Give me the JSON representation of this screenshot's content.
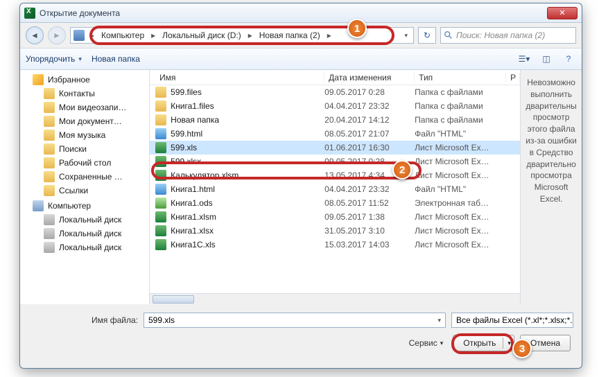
{
  "title": "Открытие документа",
  "breadcrumb": [
    "Компьютер",
    "Локальный диск (D:)",
    "Новая папка (2)"
  ],
  "search_placeholder": "Поиск: Новая папка (2)",
  "toolbar": {
    "organize": "Упорядочить",
    "newfolder": "Новая папка"
  },
  "sidebar": {
    "favorites": "Избранное",
    "items1": [
      "Контакты",
      "Мои видеозапи…",
      "Мои документ…",
      "Моя музыка",
      "Поиски",
      "Рабочий стол",
      "Сохраненные …",
      "Ссылки"
    ],
    "computer": "Компьютер",
    "drives": [
      "Локальный диск",
      "Локальный диск",
      "Локальный диск"
    ]
  },
  "columns": {
    "name": "Имя",
    "date": "Дата изменения",
    "type": "Тип",
    "r": "Р"
  },
  "files": [
    {
      "icon": "folder",
      "name": "599.files",
      "date": "09.05.2017 0:28",
      "type": "Папка с файлами"
    },
    {
      "icon": "folder",
      "name": "Книга1.files",
      "date": "04.04.2017 23:32",
      "type": "Папка с файлами"
    },
    {
      "icon": "folder",
      "name": "Новая папка",
      "date": "20.04.2017 14:12",
      "type": "Папка с файлами"
    },
    {
      "icon": "html",
      "name": "599.html",
      "date": "08.05.2017 21:07",
      "type": "Файл \"HTML\""
    },
    {
      "icon": "xls",
      "name": "599.xls",
      "date": "01.06.2017 16:30",
      "type": "Лист Microsoft Ex…",
      "selected": true
    },
    {
      "icon": "xls",
      "name": "599.xlsx",
      "date": "09.05.2017 0:28",
      "type": "Лист Microsoft Ex…"
    },
    {
      "icon": "xls",
      "name": "Калькулятор.xlsm",
      "date": "13.05.2017 4:34",
      "type": "Лист Microsoft Ex…"
    },
    {
      "icon": "html",
      "name": "Книга1.html",
      "date": "04.04.2017 23:32",
      "type": "Файл \"HTML\""
    },
    {
      "icon": "ods",
      "name": "Книга1.ods",
      "date": "08.05.2017 11:52",
      "type": "Электронная таб…"
    },
    {
      "icon": "xls",
      "name": "Книга1.xlsm",
      "date": "09.05.2017 1:38",
      "type": "Лист Microsoft Ex…"
    },
    {
      "icon": "xls",
      "name": "Книга1.xlsx",
      "date": "31.05.2017 3:10",
      "type": "Лист Microsoft Ex…"
    },
    {
      "icon": "xls",
      "name": "Книга1C.xls",
      "date": "15.03.2017 14:03",
      "type": "Лист Microsoft Ex…"
    }
  ],
  "preview": "Невозможно выполнить дварительны просмотр этого файла из-за ошибки в Средство дварительно просмотра Microsoft Excel.",
  "filename_label": "Имя файла:",
  "filename_value": "599.xls",
  "filter": "Все файлы Excel (*.xl*;*.xlsx;*.xl",
  "service": "Сервис",
  "open": "Открыть",
  "cancel": "Отмена",
  "badges": {
    "b1": "1",
    "b2": "2",
    "b3": "3"
  }
}
